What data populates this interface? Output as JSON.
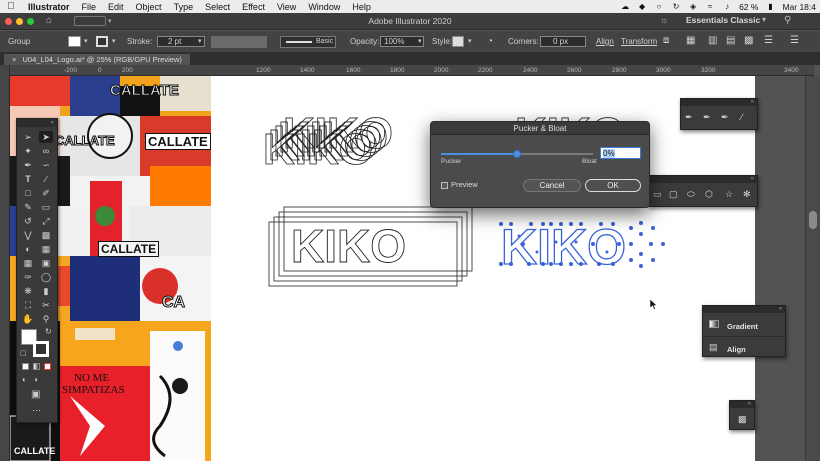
{
  "menubar": {
    "items": [
      "Illustrator",
      "File",
      "Edit",
      "Object",
      "Type",
      "Select",
      "Effect",
      "View",
      "Window",
      "Help"
    ],
    "battery": "62 %",
    "clock": "Mar 18:4"
  },
  "appbar": {
    "title": "Adobe Illustrator 2020",
    "workspace": "Essentials Classic"
  },
  "control": {
    "selection": "Group",
    "stroke_label": "Stroke:",
    "stroke_value": "2 pt",
    "profile": "Basic",
    "opacity_label": "Opacity:",
    "opacity_value": "100%",
    "style_label": "Style:",
    "corners_label": "Corners:",
    "corners_value": "0 px",
    "align": "Align",
    "transform": "Transform"
  },
  "document": {
    "tab": "U04_L04_Logo.ai* @ 25% (RGB/GPU Preview)"
  },
  "ruler": {
    "ticks": [
      "-200",
      "0",
      "200",
      "1200",
      "1400",
      "1600",
      "1800",
      "2000",
      "2200",
      "2400",
      "2600",
      "2800",
      "3000",
      "3200",
      "3400"
    ]
  },
  "artwork": {
    "word": "KIKO",
    "collage_texts": [
      "CALLATE",
      "CALLATE",
      "CALLATE",
      "CALLATE",
      "CA",
      "NO ME",
      "SIMPATIZAS",
      "CALLATE"
    ]
  },
  "dialog": {
    "title": "Pucker & Bloat",
    "value": "0%",
    "min_label": "Pucker",
    "max_label": "Bloat",
    "preview_label": "Preview",
    "cancel": "Cancel",
    "ok": "OK",
    "slider_position": 0.5
  },
  "panels": {
    "gradient": "Gradient",
    "align": "Align"
  },
  "colors": {
    "selection_blue": "#3a63d8",
    "accent": "#4a90e2"
  }
}
